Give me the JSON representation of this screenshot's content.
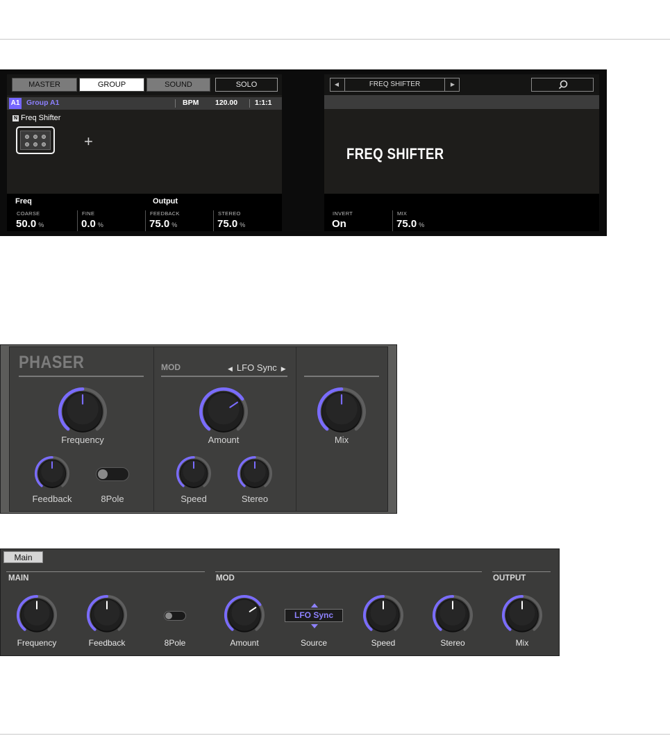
{
  "hardware": {
    "left_display": {
      "tabs": [
        "MASTER",
        "GROUP",
        "SOUND",
        "SOLO"
      ],
      "selected_tab": "GROUP",
      "group_badge": "A1",
      "group_name": "Group A1",
      "bpm_label": "BPM",
      "bpm_value": "120.00",
      "position": "1:1:1",
      "plugin_icon": "N",
      "plugin_name": "Freq Shifter",
      "add_symbol": "+",
      "sections": [
        "Freq",
        "Output"
      ],
      "params": [
        {
          "name": "COARSE",
          "value": "50.0",
          "unit": "%"
        },
        {
          "name": "FINE",
          "value": "0.0",
          "unit": "%"
        },
        {
          "name": "FEEDBACK",
          "value": "75.0",
          "unit": "%"
        },
        {
          "name": "STEREO",
          "value": "75.0",
          "unit": "%"
        }
      ]
    },
    "right_display": {
      "prev_arrow": "◀",
      "preset_name": "FREQ SHIFTER",
      "next_arrow": "▶",
      "title": "FREQ SHIFTER",
      "params": [
        {
          "name": "INVERT",
          "value": "On",
          "unit": ""
        },
        {
          "name": "MIX",
          "value": "75.0",
          "unit": "%"
        }
      ]
    }
  },
  "phaser": {
    "title": "PHASER",
    "mod_label": "MOD",
    "lfo_prev": "◀",
    "lfo_label": "LFO Sync",
    "lfo_next": "▶",
    "knobs": [
      {
        "label": "Frequency",
        "value": 0.5
      },
      {
        "label": "Feedback",
        "value": 0.5
      },
      {
        "label": "Amount",
        "value": 0.7
      },
      {
        "label": "Speed",
        "value": 0.5
      },
      {
        "label": "Stereo",
        "value": 0.5
      },
      {
        "label": "Mix",
        "value": 0.5
      }
    ],
    "toggle_label": "8Pole"
  },
  "strip": {
    "tab": "Main",
    "sections": [
      "MAIN",
      "MOD",
      "OUTPUT"
    ],
    "knobs": [
      {
        "label": "Frequency",
        "value": 0.5
      },
      {
        "label": "Feedback",
        "value": 0.5
      },
      {
        "label": "Amount",
        "value": 0.7
      },
      {
        "label": "Speed",
        "value": 0.5
      },
      {
        "label": "Stereo",
        "value": 0.5
      },
      {
        "label": "Mix",
        "value": 0.5
      }
    ],
    "toggle_label": "8Pole",
    "source_value": "LFO Sync",
    "source_label": "Source"
  },
  "colors": {
    "accent": "#7a6cff",
    "display_bg": "#1e1d1b",
    "panel_bg": "#3e3e3d"
  }
}
